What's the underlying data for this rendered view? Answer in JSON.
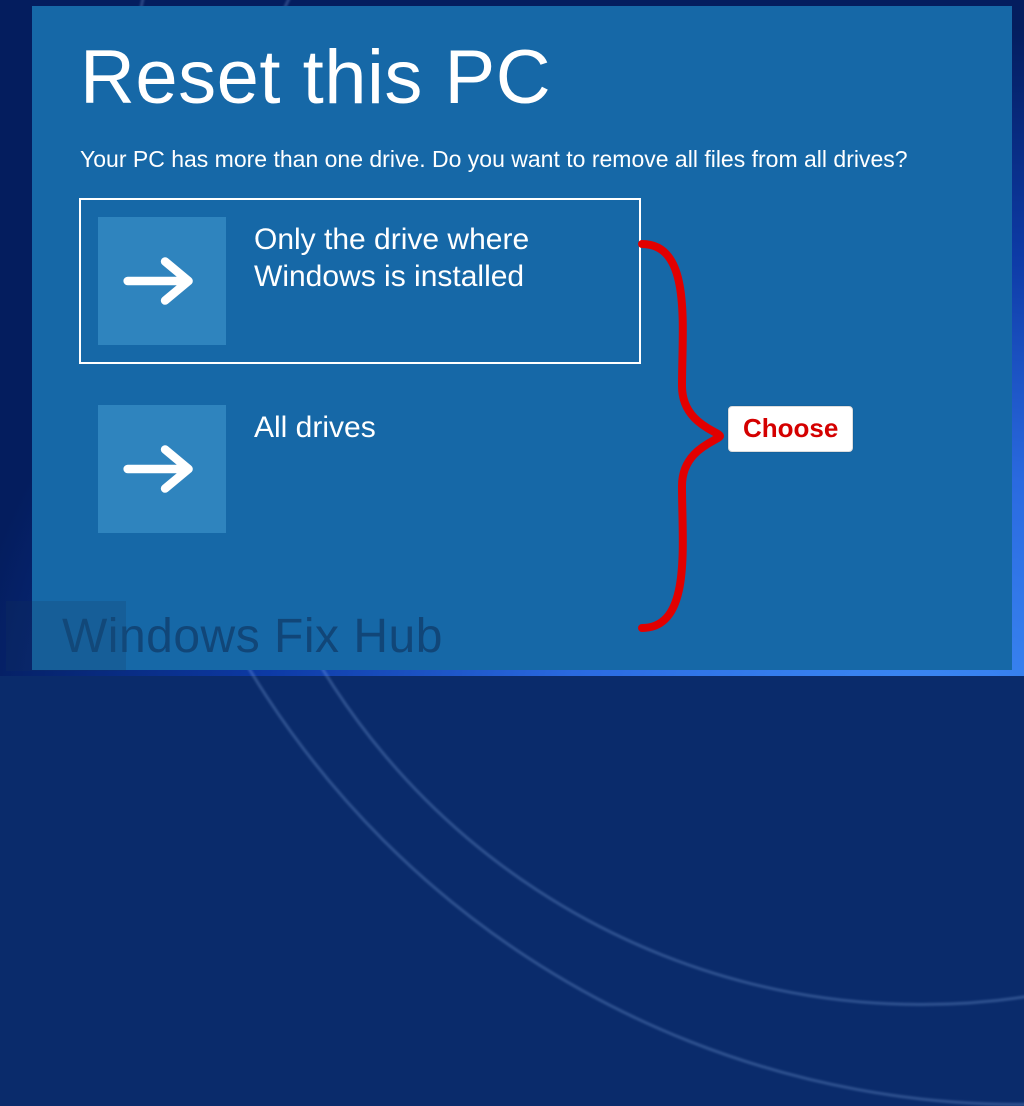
{
  "title": "Reset this PC",
  "prompt": "Your PC has more than one drive. Do you want to remove all files from all drives?",
  "options": [
    {
      "label": "Only the drive where Windows is installed",
      "selected": true
    },
    {
      "label": "All drives",
      "selected": false
    }
  ],
  "annotation": {
    "label": "Choose",
    "color": "#d40000"
  },
  "watermark": "Windows Fix Hub"
}
